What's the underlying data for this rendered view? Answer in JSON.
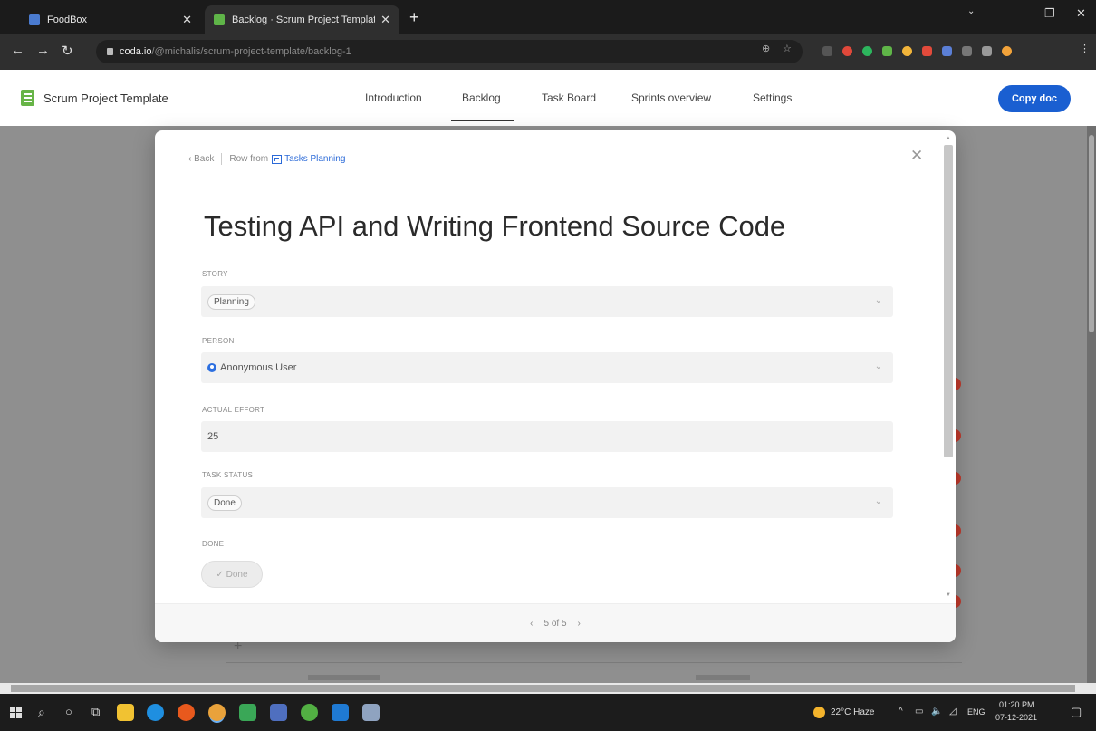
{
  "browser": {
    "tabs": [
      {
        "title": "FoodBox",
        "color": "#4a7bd0"
      },
      {
        "title": "Backlog · Scrum Project Template",
        "color": "#5fb548"
      }
    ],
    "url_host": "coda.io",
    "url_path": "/@michalis/scrum-project-template/backlog-1",
    "win_minimize": "—",
    "win_maximize": "❐",
    "win_close": "✕",
    "new_tab": "+",
    "tab_close": "✕"
  },
  "app": {
    "doc_title": "Scrum Project Template",
    "nav": [
      "Introduction",
      "Backlog",
      "Task Board",
      "Sprints overview",
      "Settings"
    ],
    "copy_label": "Copy doc"
  },
  "modal": {
    "back_label": "‹ Back",
    "row_from_label": "Row from",
    "table_name": "Tasks Planning",
    "title": "Testing API and Writing Frontend Source Code",
    "fields": {
      "story": {
        "label": "STORY",
        "value": "Planning"
      },
      "person": {
        "label": "PERSON",
        "value": "Anonymous User"
      },
      "effort": {
        "label": "ACTUAL EFFORT",
        "value": "25"
      },
      "status": {
        "label": "TASK STATUS",
        "value": "Done"
      },
      "done": {
        "label": "DONE",
        "value": "✓ Done"
      }
    },
    "pager": {
      "prev": "‹",
      "text": "5 of 5",
      "next": "›"
    },
    "close_glyph": "✕"
  },
  "taskbar": {
    "weather": "22°C Haze",
    "lang": "ENG",
    "time": "01:20 PM",
    "date": "07-12-2021"
  }
}
